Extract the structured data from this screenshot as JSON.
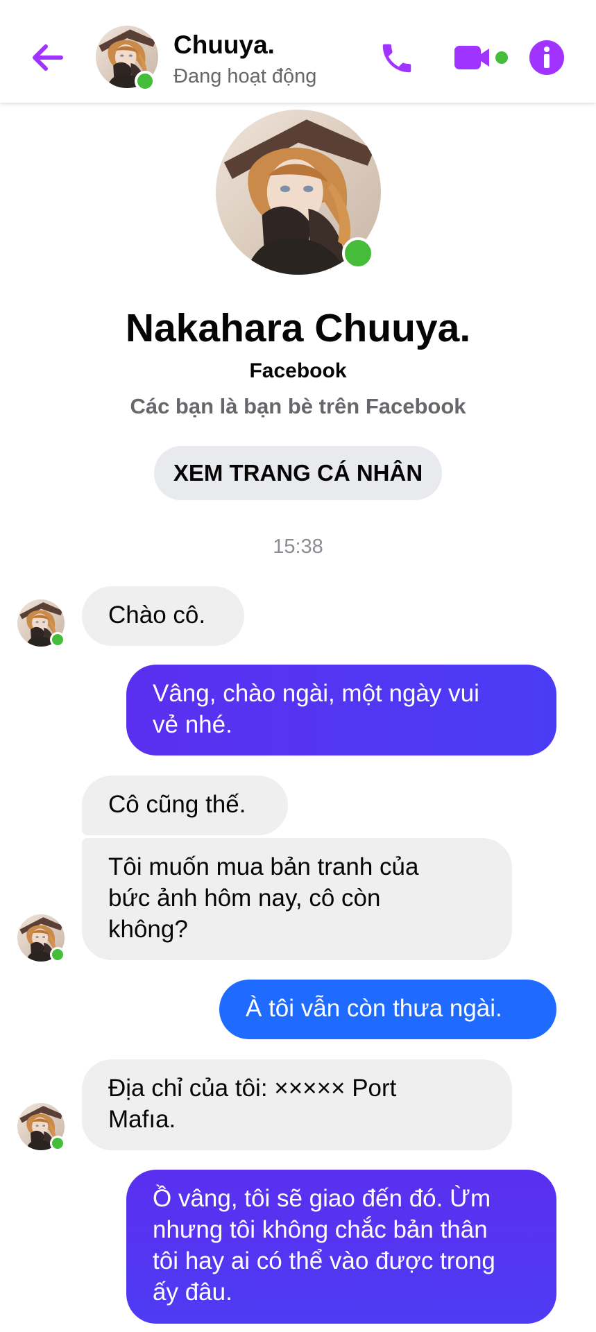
{
  "header": {
    "name": "Chuuya.",
    "status": "Đang hoạt động",
    "back_icon": "arrow-left-icon",
    "call_icon": "phone-icon",
    "video_icon": "video-camera-icon",
    "info_icon": "info-icon"
  },
  "profile": {
    "name": "Nakahara Chuuya.",
    "platform": "Facebook",
    "relationship": "Các bạn là bạn bè trên Facebook",
    "view_profile_label": "XEM TRANG CÁ NHÂN"
  },
  "timestamp": "15:38",
  "messages": [
    {
      "from": "them",
      "text": "Chào cô."
    },
    {
      "from": "me",
      "text": "Vâng, chào ngài, một ngày vui\nvẻ nhé."
    },
    {
      "from": "them",
      "text": "Cô cũng thế."
    },
    {
      "from": "them",
      "text": "Tôi muốn mua bản tranh của\nbức ảnh hôm nay, cô còn\nkhông?"
    },
    {
      "from": "me",
      "text": "À tôi vẫn còn thưa ngài."
    },
    {
      "from": "them",
      "text": "Địa chỉ của tôi: ××××× Port\nMafıa."
    },
    {
      "from": "me",
      "text": "Ồ vâng, tôi sẽ giao đến đó. Ừm\nnhưng tôi không chắc bản thân\ntôi hay ai có thể vào được trong\nấy đâu."
    }
  ],
  "colors": {
    "accent": "#a033ff",
    "online": "#45bd3a",
    "incoming_bubble": "#efefef",
    "outgoing_gradient": [
      "#5b2ff0",
      "#1f6bff"
    ]
  }
}
